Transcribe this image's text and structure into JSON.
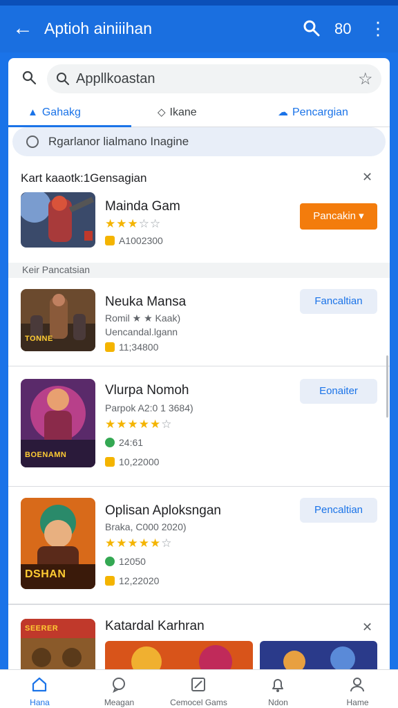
{
  "appbar": {
    "title": "Aptioh ainiiihan",
    "count": "80"
  },
  "search": {
    "placeholder": "Appllkoastan"
  },
  "tabs": [
    {
      "label": "Gahakg",
      "active": true
    },
    {
      "label": "Ikane",
      "active": false
    },
    {
      "label": "Pencargian",
      "active": false
    }
  ],
  "filter": {
    "label": "Rgarlanor lialmano Inagine"
  },
  "featured": {
    "title": "Kart kaaotk:1Gensagian",
    "app": {
      "name": "Mainda Gam",
      "rating_stars": 3,
      "meta": "A1002300",
      "button": "Pancakin ▾"
    }
  },
  "subheader": "Keir Pancatsian",
  "apps": [
    {
      "name": "Neuka Mansa",
      "line1": "Romil ★ ★ Kaak)",
      "line2": "Uencandal.lgann",
      "meta": "11;34800",
      "button": "Fancaltian",
      "thumb_text": "TONNE"
    },
    {
      "name": "Vlurpa Nomoh",
      "line1": "Parpok A2:0 1 3684)",
      "rating_stars": 5,
      "line2": "24:61",
      "meta": "10,22000",
      "button": "Eonaiter",
      "thumb_text": "BOENAMN"
    },
    {
      "name": "Oplisan Aploksngan",
      "line1": "Braka, C000 2020)",
      "rating_stars": 5,
      "line2": "12050",
      "meta": "12,22020",
      "button": "Pencaltian",
      "thumb_text": "DSHAN"
    }
  ],
  "section5": {
    "title": "Katardal Karhran",
    "thumb_text": "SEERER"
  },
  "bottom_nav": [
    {
      "label": "Hana",
      "icon": "home-icon",
      "active": true
    },
    {
      "label": "Meagan",
      "icon": "chat-icon",
      "active": false
    },
    {
      "label": "Cemocel Gams",
      "icon": "games-icon",
      "active": false
    },
    {
      "label": "Ndon",
      "icon": "bell-icon",
      "active": false
    },
    {
      "label": "Hame",
      "icon": "profile-icon",
      "active": false
    }
  ],
  "colors": {
    "primary": "#1a6fe0",
    "accent": "#f37c0c",
    "star": "#f4b400"
  }
}
